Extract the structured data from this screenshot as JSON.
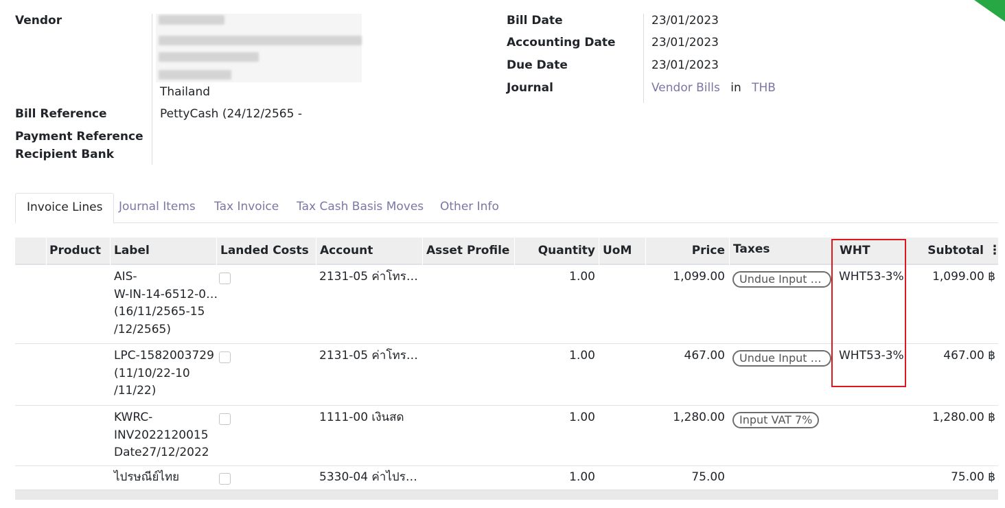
{
  "form": {
    "vendor_label": "Vendor",
    "vendor_country": "Thailand",
    "bill_reference_label": "Bill Reference",
    "bill_reference_value": "PettyCash (24/12/2565 -",
    "payment_reference_label": "Payment Reference",
    "recipient_bank_label": "Recipient Bank",
    "bill_date_label": "Bill Date",
    "bill_date_value": "23/01/2023",
    "accounting_date_label": "Accounting Date",
    "accounting_date_value": "23/01/2023",
    "due_date_label": "Due Date",
    "due_date_value": "23/01/2023",
    "journal_label": "Journal",
    "journal_value": "Vendor Bills",
    "journal_in": "in",
    "journal_currency": "THB"
  },
  "tabs": [
    "Invoice Lines",
    "Journal Items",
    "Tax Invoice",
    "Tax Cash Basis Moves",
    "Other Info"
  ],
  "table": {
    "headers": {
      "product": "Product",
      "label": "Label",
      "landed_costs": "Landed Costs",
      "account": "Account",
      "asset_profile": "Asset Profile",
      "quantity": "Quantity",
      "uom": "UoM",
      "price": "Price",
      "taxes": "Taxes",
      "wht": "WHT",
      "subtotal": "Subtotal",
      "menu": "⋮"
    },
    "rows": [
      {
        "label_lines": [
          "AIS-",
          "W-IN-14-6512-0…",
          "(16/11/2565-15",
          "/12/2565)"
        ],
        "account": "2131-05 ค่าโทร…",
        "quantity": "1.00",
        "price": "1,099.00",
        "tax": "Undue Input …",
        "wht": "WHT53-3%",
        "subtotal": "1,099.00 ฿"
      },
      {
        "label_lines": [
          "LPC-1582003729",
          "(11/10/22-10",
          "/11/22)"
        ],
        "account": "2131-05 ค่าโทร…",
        "quantity": "1.00",
        "price": "467.00",
        "tax": "Undue Input …",
        "wht": "WHT53-3%",
        "subtotal": "467.00 ฿"
      },
      {
        "label_lines": [
          "KWRC-",
          "INV2022120015",
          "Date27/12/2022"
        ],
        "account": "1111-00 เงินสด",
        "quantity": "1.00",
        "price": "1,280.00",
        "tax": "Input VAT 7%",
        "wht": "",
        "subtotal": "1,280.00 ฿"
      },
      {
        "label_lines": [
          "ไปรษณีย์ไทย"
        ],
        "account": "5330-04 ค่าไปร…",
        "quantity": "1.00",
        "price": "75.00",
        "tax": "",
        "wht": "",
        "subtotal": "75.00 ฿"
      }
    ]
  },
  "colors": {
    "link": "#7a77a5",
    "highlight": "#e0161b",
    "ribbon": "#28a745"
  }
}
